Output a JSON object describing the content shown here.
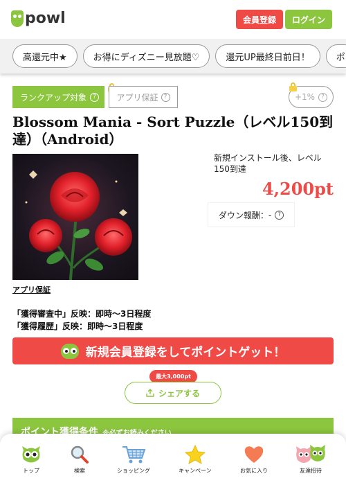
{
  "header": {
    "logo_text": "powl",
    "register_label": "会員登録",
    "login_label": "ログイン"
  },
  "campaign_tabs": [
    {
      "label": "高還元中★"
    },
    {
      "label": "お得にディズニー見放題♡"
    },
    {
      "label": "還元UP最終日前日！"
    },
    {
      "label": "ポ"
    }
  ],
  "badges": {
    "rank_up": "ランクアップ対象",
    "app_guarantee": "アプリ保証",
    "percent": "+1%"
  },
  "offer": {
    "title": "Blossom Mania - Sort Puzzle（レベル150到達）（Android）",
    "condition": "新規インストール後、レベル150到達",
    "points": "4,200pt",
    "down_reward": "ダウン報酬：-",
    "app_guarantee_link": "アプリ保証",
    "reflect_review": "「獲得審査中」反映：即時～3日程度",
    "reflect_history": "「獲得履歴」反映：即時～3日程度"
  },
  "cta": {
    "label": "新規会員登録をしてポイントゲット！"
  },
  "share": {
    "max_label": "最大3,000pt",
    "label": "シェアする"
  },
  "conditions": {
    "title": "ポイント獲得条件",
    "note": "※必ずお読みください"
  },
  "bottom_nav": [
    {
      "label": "トップ",
      "icon": "owl-icon"
    },
    {
      "label": "検索",
      "icon": "search-icon"
    },
    {
      "label": "ショッピング",
      "icon": "cart-icon"
    },
    {
      "label": "キャンペーン",
      "icon": "star-icon"
    },
    {
      "label": "お気に入り",
      "icon": "heart-icon"
    },
    {
      "label": "友達招待",
      "icon": "friends-icon"
    }
  ],
  "colors": {
    "brand_green": "#8cc63f",
    "accent_red": "#f04a47"
  }
}
